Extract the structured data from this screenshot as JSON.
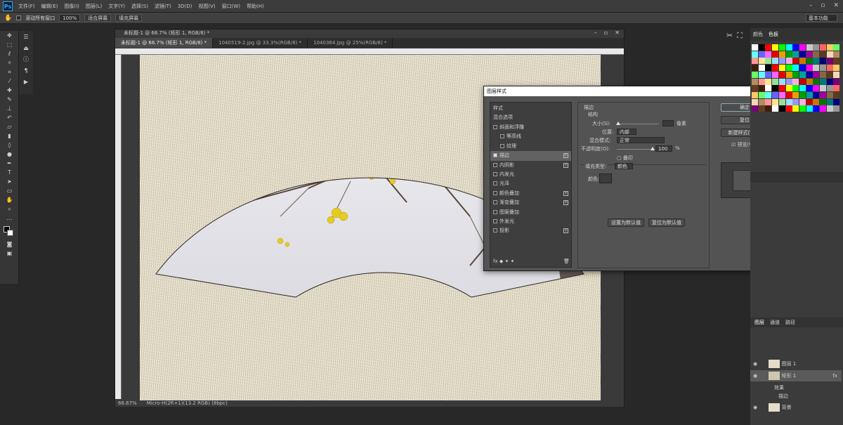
{
  "app": {
    "logo": "Ps",
    "menus": [
      "文件(F)",
      "编辑(E)",
      "图像(I)",
      "图层(L)",
      "文字(Y)",
      "选择(S)",
      "滤镜(T)",
      "3D(D)",
      "视图(V)",
      "窗口(W)",
      "帮助(H)"
    ]
  },
  "options": {
    "auto_select": "滚动所有窗口",
    "zoom": "100%",
    "fit_screen": "适合屏幕",
    "fill_screen": "填充屏幕",
    "workspace": "基本功能"
  },
  "document": {
    "window_title": "未标题-1 @ 66.7% (矩形 1, RGB/8) *",
    "tabs": [
      "未标题-1 @ 66.7% (矩形 1, RGB/8) *",
      "1040519-2.jpg @ 33.3%(RGB/8) *",
      "1040364.jpg @ 25%(RGB/8) *"
    ],
    "status_zoom": "66.67%",
    "status_doc": "Micro-H(2R+1)(13.2 RGB) (8bpc)"
  },
  "dialog": {
    "title": "图层样式",
    "close": "✕",
    "styles_header": "样式",
    "blend_options": "混合选项",
    "effects": [
      {
        "label": "斜面和浮雕",
        "checked": false,
        "plus": false
      },
      {
        "label": "等高线",
        "checked": false,
        "plus": false,
        "sub": true
      },
      {
        "label": "纹理",
        "checked": false,
        "plus": false,
        "sub": true
      },
      {
        "label": "描边",
        "checked": true,
        "plus": true,
        "selected": true
      },
      {
        "label": "内阴影",
        "checked": false,
        "plus": true
      },
      {
        "label": "内发光",
        "checked": false,
        "plus": false
      },
      {
        "label": "光泽",
        "checked": false,
        "plus": false
      },
      {
        "label": "颜色叠加",
        "checked": false,
        "plus": true
      },
      {
        "label": "渐变叠加",
        "checked": false,
        "plus": true
      },
      {
        "label": "图案叠加",
        "checked": false,
        "plus": false
      },
      {
        "label": "外发光",
        "checked": false,
        "plus": false
      },
      {
        "label": "投影",
        "checked": false,
        "plus": true
      }
    ],
    "fx_footer": "fx ◆ ✦ ✦",
    "trash": "🗑",
    "stroke": {
      "section": "描边",
      "structure": "结构",
      "size_label": "大小(S):",
      "size_unit": "像素",
      "position_label": "位置:",
      "position_value": "内部",
      "blend_label": "混合模式:",
      "blend_value": "正常",
      "opacity_label": "不透明度(O):",
      "opacity_value": "100",
      "opacity_unit": "%",
      "overprint": "叠印",
      "fill_type_label": "填充类型:",
      "fill_type_value": "颜色",
      "color_label": "颜色:",
      "default_btn": "设置为默认值",
      "reset_btn": "复位为默认值"
    },
    "buttons": {
      "ok": "确定",
      "cancel": "复位",
      "new_style": "新建样式(W)...",
      "preview": "预览(V)"
    }
  },
  "right_panels": {
    "tabs": [
      "颜色",
      "色板"
    ],
    "swatch_colors": [
      "#ffffff",
      "#000000",
      "#ff0000",
      "#ffff00",
      "#00ff00",
      "#00ffff",
      "#0000ff",
      "#ff00ff",
      "#c8c8c8",
      "#969696",
      "#ff6464",
      "#ffc864",
      "#64ff64",
      "#64ffff",
      "#6464ff",
      "#ff64ff",
      "#e60000",
      "#e6a000",
      "#00a000",
      "#00a0a0",
      "#0000a0",
      "#a000a0",
      "#8c6446",
      "#5a3c1e",
      "#f5d7b4",
      "#b48c64",
      "#ff9696",
      "#ffe196",
      "#96e196",
      "#96e1ff",
      "#9696ff",
      "#ffafe1",
      "#c80000",
      "#c87800",
      "#007800",
      "#007878",
      "#000078",
      "#780078",
      "#643c1e",
      "#3c1e0a"
    ],
    "layer_tabs": [
      "图层",
      "通道",
      "路径"
    ],
    "layers": [
      {
        "name": "图层 1",
        "visible": true
      },
      {
        "name": "矩形 1",
        "visible": true,
        "fx": "fx"
      },
      {
        "name": "效果",
        "sub": true
      },
      {
        "name": "描边",
        "sub": true
      },
      {
        "name": "背景",
        "visible": true
      }
    ]
  }
}
